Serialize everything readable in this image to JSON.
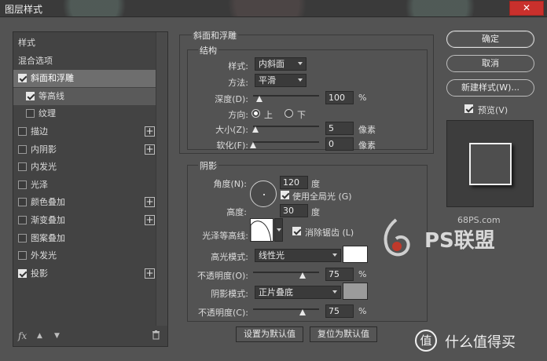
{
  "window": {
    "title": "图层样式",
    "close_label": "✕"
  },
  "left": {
    "items": [
      {
        "label": "样式",
        "checkbox": false,
        "checked": false,
        "plus": false,
        "indent": 0
      },
      {
        "label": "混合选项",
        "checkbox": false,
        "checked": false,
        "plus": false,
        "indent": 0
      },
      {
        "label": "斜面和浮雕",
        "checkbox": true,
        "checked": true,
        "plus": false,
        "indent": 0,
        "selected": true
      },
      {
        "label": "等高线",
        "checkbox": true,
        "checked": true,
        "plus": false,
        "indent": 1
      },
      {
        "label": "纹理",
        "checkbox": true,
        "checked": false,
        "plus": false,
        "indent": 1
      },
      {
        "label": "描边",
        "checkbox": true,
        "checked": false,
        "plus": true,
        "indent": 0
      },
      {
        "label": "内阴影",
        "checkbox": true,
        "checked": false,
        "plus": true,
        "indent": 0
      },
      {
        "label": "内发光",
        "checkbox": true,
        "checked": false,
        "plus": false,
        "indent": 0
      },
      {
        "label": "光泽",
        "checkbox": true,
        "checked": false,
        "plus": false,
        "indent": 0
      },
      {
        "label": "颜色叠加",
        "checkbox": true,
        "checked": false,
        "plus": true,
        "indent": 0
      },
      {
        "label": "渐变叠加",
        "checkbox": true,
        "checked": false,
        "plus": true,
        "indent": 0
      },
      {
        "label": "图案叠加",
        "checkbox": true,
        "checked": false,
        "plus": false,
        "indent": 0
      },
      {
        "label": "外发光",
        "checkbox": true,
        "checked": false,
        "plus": false,
        "indent": 0
      },
      {
        "label": "投影",
        "checkbox": true,
        "checked": true,
        "plus": true,
        "indent": 0
      }
    ],
    "fx_label": "fx",
    "up_icon": "▲",
    "down_icon": "▼",
    "trash_icon": "🗑"
  },
  "bevel": {
    "group_title": "斜面和浮雕",
    "structure_title": "结构",
    "style_label": "样式:",
    "style_value": "内斜面",
    "method_label": "方法:",
    "method_value": "平滑",
    "depth_label": "深度(D):",
    "depth_value": "100",
    "depth_unit": "%",
    "depth_fraction": 0.1,
    "direction_label": "方向:",
    "dir_up": "上",
    "dir_down": "下",
    "size_label": "大小(Z):",
    "size_value": "5",
    "size_unit": "像素",
    "size_fraction": 0.03,
    "soften_label": "软化(F):",
    "soften_value": "0",
    "soften_unit": "像素",
    "soften_fraction": 0.0
  },
  "shading": {
    "title": "阴影",
    "angle_label": "角度(N):",
    "angle_value": "120",
    "angle_unit": "度",
    "global_light_label": "使用全局光 (G)",
    "altitude_label": "高度:",
    "altitude_value": "30",
    "altitude_unit": "度",
    "gloss_label": "光泽等高线:",
    "antialias_label": "消除锯齿 (L)",
    "highlight_mode_label": "高光模式:",
    "highlight_mode_value": "线性光",
    "highlight_color": "#ffffff",
    "highlight_opacity_label": "不透明度(O):",
    "highlight_opacity_value": "75",
    "highlight_opacity_unit": "%",
    "highlight_opacity_fraction": 0.75,
    "shadow_mode_label": "阴影模式:",
    "shadow_mode_value": "正片叠底",
    "shadow_color": "#9b9b9b",
    "shadow_opacity_label": "不透明度(C):",
    "shadow_opacity_value": "75",
    "shadow_opacity_unit": "%",
    "shadow_opacity_fraction": 0.75
  },
  "buttons": {
    "set_default": "设置为默认值",
    "reset_default": "复位为默认值",
    "ok": "确定",
    "cancel": "取消",
    "new_style": "新建样式(W)...",
    "preview_label": "预览(V)"
  },
  "watermarks": {
    "site": "68PS.com",
    "brand": "PS联盟",
    "bottom": "什么值得买",
    "bottom_badge": "值"
  }
}
